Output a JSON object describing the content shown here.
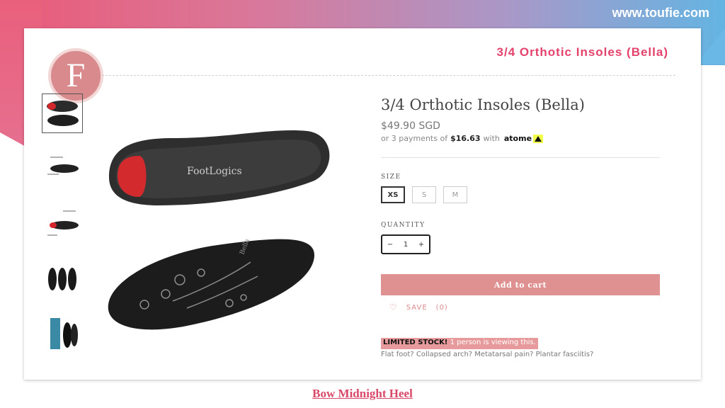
{
  "header": {
    "site_url": "www.toufie.com"
  },
  "slide": {
    "logo_letter": "F",
    "title": "3/4 Orthotic Insoles (Bella)",
    "footer_link": "Bow Midnight Heel"
  },
  "product": {
    "title": "3/4 Orthotic Insoles (Bella)",
    "price": "$49.90 SGD",
    "installment_prefix": "or 3 payments of",
    "installment_amount": "$16.63",
    "installment_suffix": "with",
    "installment_brand": "atome",
    "size_label": "SIZE",
    "sizes": [
      "XS",
      "S",
      "M"
    ],
    "selected_size": "XS",
    "quantity_label": "QUANTITY",
    "quantity_value": "1",
    "qty_minus": "−",
    "qty_plus": "+",
    "add_to_cart": "Add to cart",
    "save_label": "SAVE",
    "save_count": "(0)",
    "limited_stock": "LIMITED STOCK!",
    "viewing": "1 person is viewing this.",
    "symptoms": "Flat foot? Collapsed arch? Metatarsal pain? Plantar fasciitis?"
  },
  "icons": {
    "heart": "heart-icon",
    "logo": "toufie-logo"
  },
  "colors": {
    "accent": "#e4416b",
    "cart_button": "#df9192",
    "logo": "#d88a8c"
  }
}
